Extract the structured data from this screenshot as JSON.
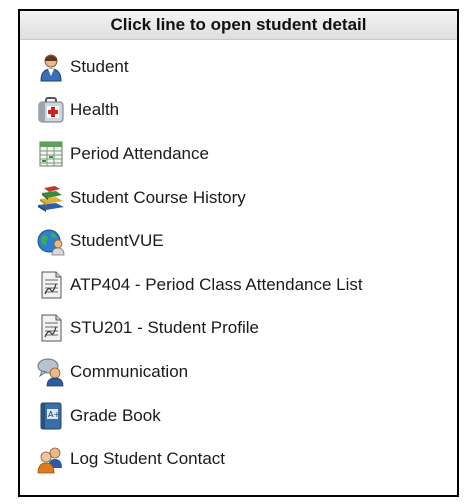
{
  "header": {
    "title": "Click line to open student detail"
  },
  "items": [
    {
      "label": "Student",
      "icon": "student-icon"
    },
    {
      "label": "Health",
      "icon": "health-kit-icon"
    },
    {
      "label": "Period Attendance",
      "icon": "attendance-sheet-icon"
    },
    {
      "label": "Student Course History",
      "icon": "books-icon"
    },
    {
      "label": "StudentVUE",
      "icon": "globe-user-icon"
    },
    {
      "label": "ATP404 - Period Class Attendance List",
      "icon": "report-document-icon"
    },
    {
      "label": "STU201 - Student Profile",
      "icon": "report-document-icon"
    },
    {
      "label": "Communication",
      "icon": "communication-user-icon"
    },
    {
      "label": "Grade Book",
      "icon": "grade-book-icon"
    },
    {
      "label": "Log Student Contact",
      "icon": "contacts-icon"
    }
  ]
}
